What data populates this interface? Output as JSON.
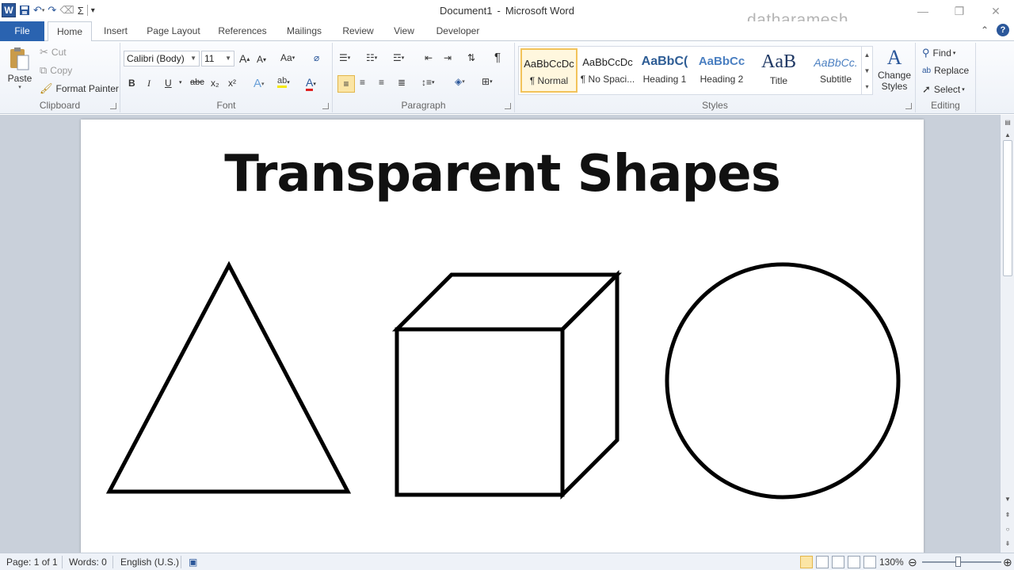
{
  "window": {
    "doc_name": "Document1",
    "separator": "-",
    "app_name": "Microsoft Word",
    "watermark": "datharamesh"
  },
  "qat": {
    "logo": "W",
    "customize": "▾"
  },
  "tabs": [
    {
      "label": "File"
    },
    {
      "label": "Home"
    },
    {
      "label": "Insert"
    },
    {
      "label": "Page Layout"
    },
    {
      "label": "References"
    },
    {
      "label": "Mailings"
    },
    {
      "label": "Review"
    },
    {
      "label": "View"
    },
    {
      "label": "Developer"
    }
  ],
  "ribbon": {
    "clipboard": {
      "label": "Clipboard",
      "paste": "Paste",
      "cut": "Cut",
      "copy": "Copy",
      "format_painter": "Format Painter"
    },
    "font": {
      "label": "Font",
      "font_name": "Calibri (Body)",
      "font_size": "11",
      "change_case": "Aa",
      "bold": "B",
      "italic": "I",
      "underline": "U",
      "strike": "abc",
      "subscript": "x₂",
      "superscript": "x²"
    },
    "paragraph": {
      "label": "Paragraph",
      "pilcrow": "¶"
    },
    "styles": {
      "label": "Styles",
      "items": [
        {
          "sample": "AaBbCcDc",
          "name": "¶ Normal"
        },
        {
          "sample": "AaBbCcDc",
          "name": "¶ No Spaci..."
        },
        {
          "sample": "AaBbC(",
          "name": "Heading 1"
        },
        {
          "sample": "AaBbCc",
          "name": "Heading 2"
        },
        {
          "sample": "AaB",
          "name": "Title"
        },
        {
          "sample": "AaBbCc.",
          "name": "Subtitle"
        }
      ],
      "change_styles": "Change Styles"
    },
    "editing": {
      "label": "Editing",
      "find": "Find",
      "replace": "Replace",
      "select": "Select"
    }
  },
  "document": {
    "heading": "Transparent Shapes"
  },
  "status": {
    "page": "Page: 1 of 1",
    "words": "Words: 0",
    "language": "English (U.S.)",
    "zoom": "130%",
    "zoom_level": 0.45
  }
}
